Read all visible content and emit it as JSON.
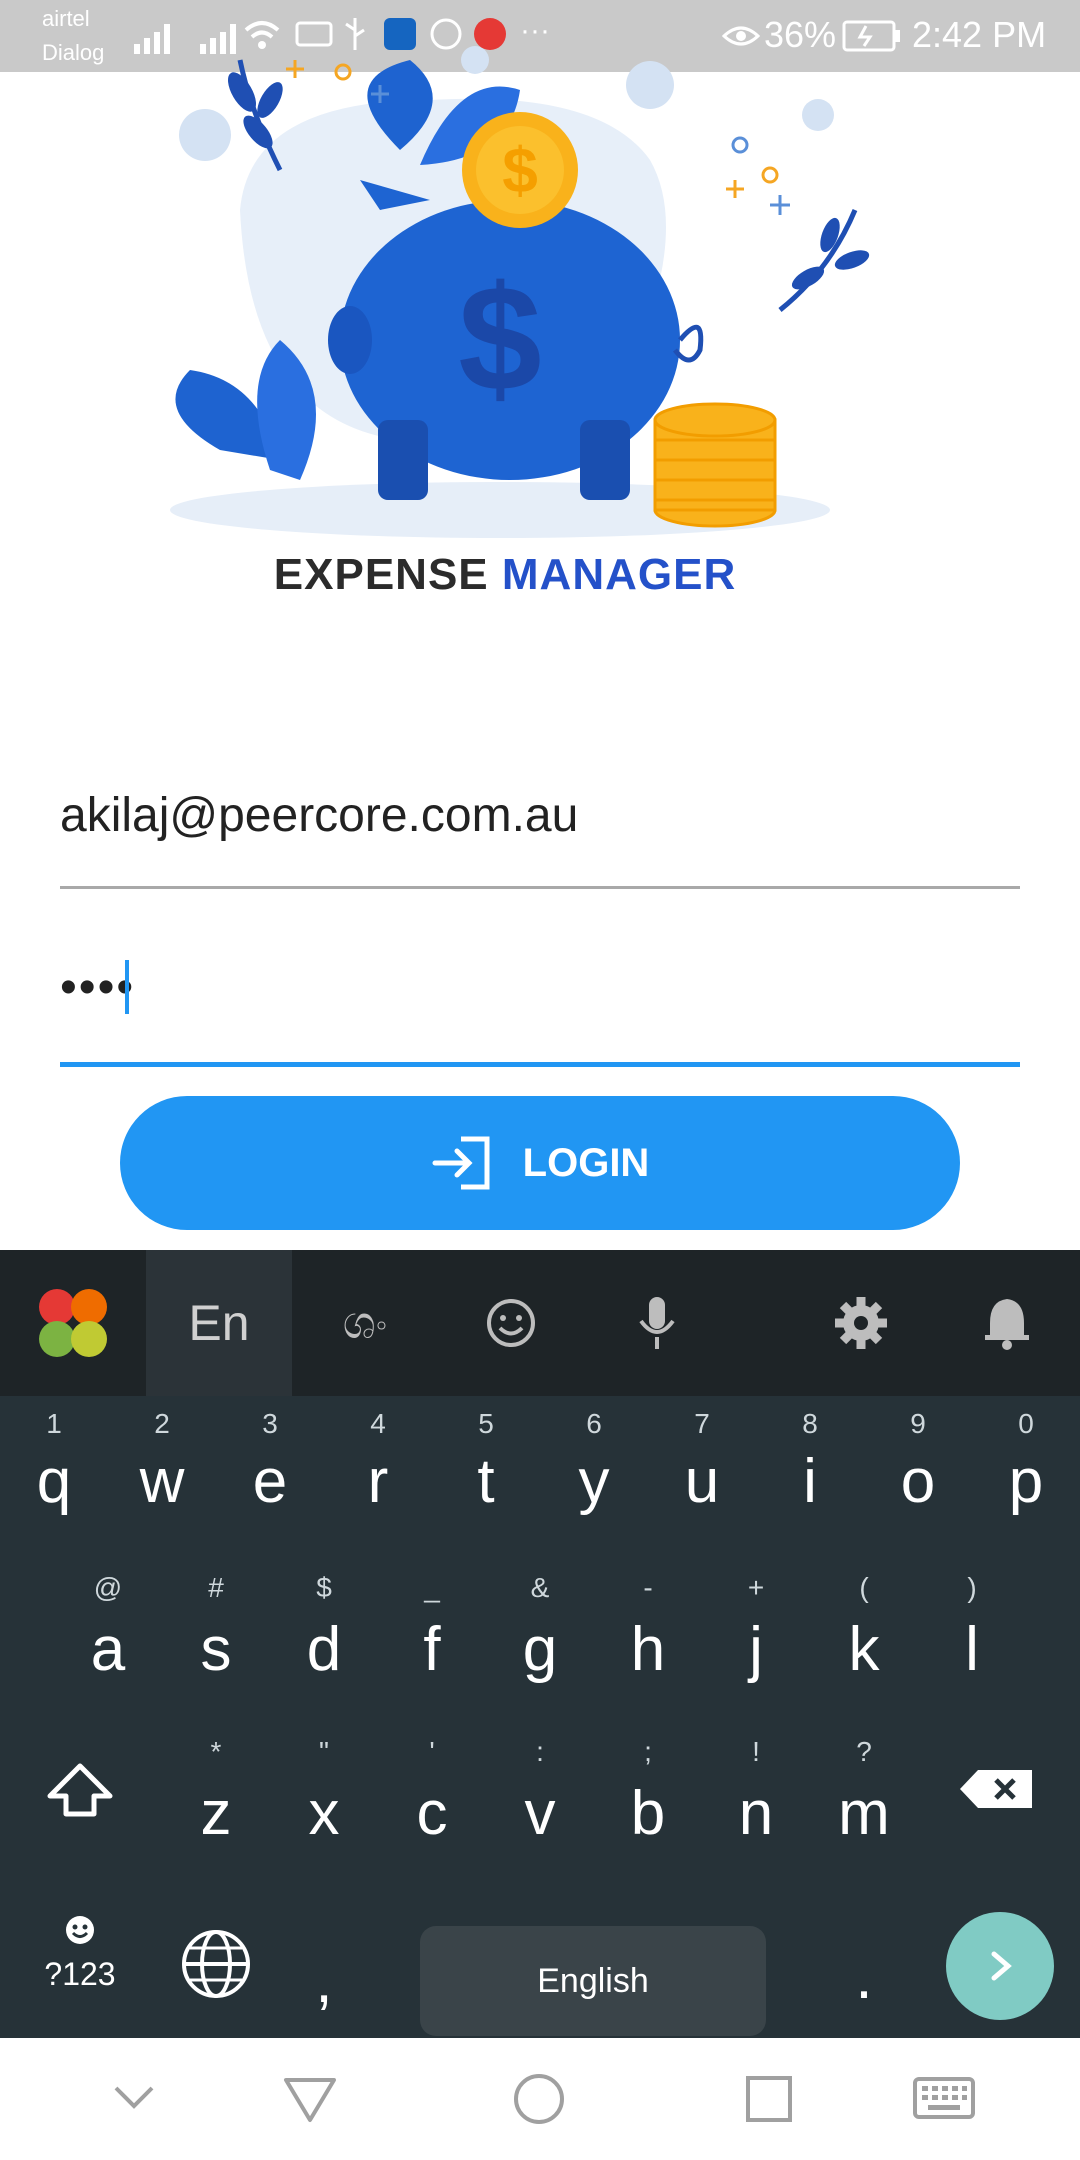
{
  "status_bar": {
    "carrier_line1": "airtel",
    "carrier_line2": "Dialog",
    "battery": "36%",
    "time": "2:42 PM"
  },
  "brand": {
    "word1": "EXPENSE",
    "word2": "MANAGER"
  },
  "login_form": {
    "email_value": "akilaj@peercore.com.au",
    "password_value": "••••",
    "login_label": "LOGIN"
  },
  "keyboard": {
    "lang_tab": "En",
    "row1": [
      {
        "hint": "1",
        "key": "q"
      },
      {
        "hint": "2",
        "key": "w"
      },
      {
        "hint": "3",
        "key": "e"
      },
      {
        "hint": "4",
        "key": "r"
      },
      {
        "hint": "5",
        "key": "t"
      },
      {
        "hint": "6",
        "key": "y"
      },
      {
        "hint": "7",
        "key": "u"
      },
      {
        "hint": "8",
        "key": "i"
      },
      {
        "hint": "9",
        "key": "o"
      },
      {
        "hint": "0",
        "key": "p"
      }
    ],
    "row2": [
      {
        "hint": "@",
        "key": "a"
      },
      {
        "hint": "#",
        "key": "s"
      },
      {
        "hint": "$",
        "key": "d"
      },
      {
        "hint": "_",
        "key": "f"
      },
      {
        "hint": "&",
        "key": "g"
      },
      {
        "hint": "-",
        "key": "h"
      },
      {
        "hint": "+",
        "key": "j"
      },
      {
        "hint": "(",
        "key": "k"
      },
      {
        "hint": ")",
        "key": "l"
      }
    ],
    "row3": [
      {
        "hint": "*",
        "key": "z"
      },
      {
        "hint": "\"",
        "key": "x"
      },
      {
        "hint": "'",
        "key": "c"
      },
      {
        "hint": ":",
        "key": "v"
      },
      {
        "hint": ";",
        "key": "b"
      },
      {
        "hint": "!",
        "key": "n"
      },
      {
        "hint": "?",
        "key": "m"
      }
    ],
    "symbols_label": "?123",
    "comma": ",",
    "space_label": "English",
    "period": "."
  },
  "colors": {
    "accent": "#2196f3",
    "brand_blue": "#2451c9",
    "keyboard_bg": "#263238",
    "enter_key": "#80cbc4"
  }
}
